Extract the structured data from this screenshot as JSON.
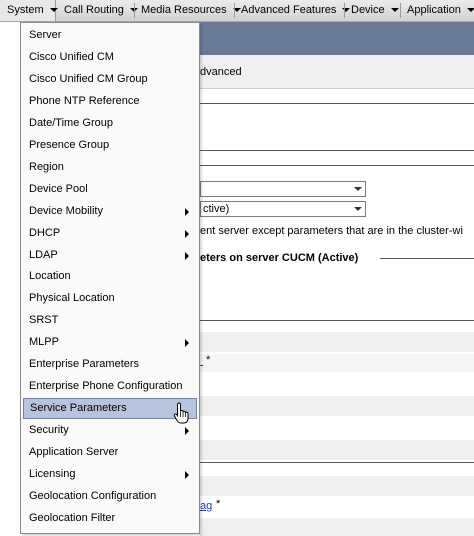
{
  "menubar": {
    "items": [
      "System",
      "Call Routing",
      "Media Resources",
      "Advanced Features",
      "Device",
      "Application"
    ]
  },
  "background": {
    "toolbar_partial": "dvanced",
    "select_row1": "",
    "select_row2": "ctive)",
    "info_text": "ent server except parameters that are in the cluster-wi",
    "fieldset_title": "eters on server CUCM (Active)",
    "star1": "*",
    "link2_text": "ag",
    "star2": "*"
  },
  "dropdown": {
    "items": [
      {
        "label": "Server",
        "submenu": false
      },
      {
        "label": "Cisco Unified CM",
        "submenu": false
      },
      {
        "label": "Cisco Unified CM Group",
        "submenu": false
      },
      {
        "label": "Phone NTP Reference",
        "submenu": false
      },
      {
        "label": "Date/Time Group",
        "submenu": false
      },
      {
        "label": "Presence Group",
        "submenu": false
      },
      {
        "label": "Region",
        "submenu": false
      },
      {
        "label": "Device Pool",
        "submenu": false
      },
      {
        "label": "Device Mobility",
        "submenu": true
      },
      {
        "label": "DHCP",
        "submenu": true
      },
      {
        "label": "LDAP",
        "submenu": true
      },
      {
        "label": "Location",
        "submenu": false
      },
      {
        "label": "Physical Location",
        "submenu": false
      },
      {
        "label": "SRST",
        "submenu": false
      },
      {
        "label": "MLPP",
        "submenu": true
      },
      {
        "label": "Enterprise Parameters",
        "submenu": false
      },
      {
        "label": "Enterprise Phone Configuration",
        "submenu": false
      },
      {
        "label": "Service Parameters",
        "submenu": false,
        "active": true
      },
      {
        "label": "Security",
        "submenu": true
      },
      {
        "label": "Application Server",
        "submenu": false
      },
      {
        "label": "Licensing",
        "submenu": true
      },
      {
        "label": "Geolocation Configuration",
        "submenu": false
      },
      {
        "label": "Geolocation Filter",
        "submenu": false
      }
    ]
  },
  "colors": {
    "highlight": "#b8c4dd",
    "header_blue": "#6b7a99",
    "link": "#1a3fbf"
  }
}
